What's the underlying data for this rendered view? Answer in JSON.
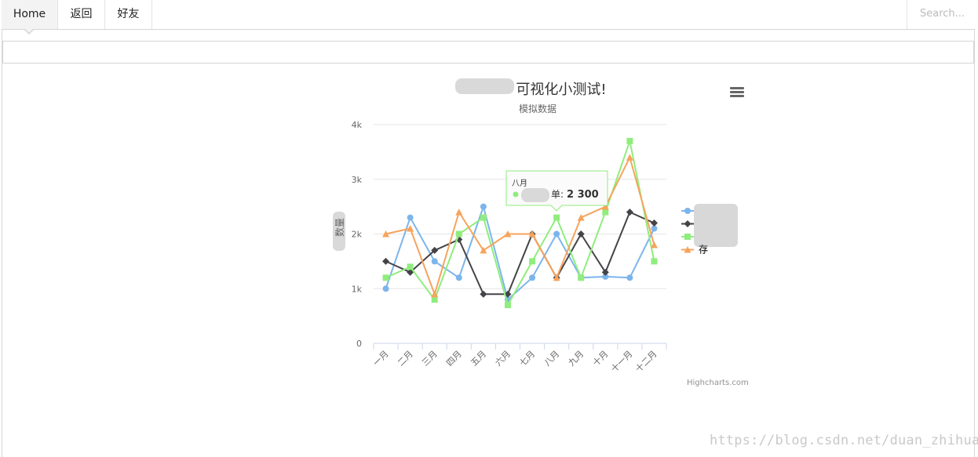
{
  "nav": {
    "items": [
      {
        "label": "Home",
        "active": true
      },
      {
        "label": "返回",
        "active": false
      },
      {
        "label": "好友",
        "active": false
      }
    ],
    "search_placeholder": "Search..."
  },
  "chart_data": {
    "type": "line",
    "title": "可视化小测试!",
    "subtitle": "模拟数据",
    "ylabel": "数量",
    "ylim": [
      0,
      4000
    ],
    "yticks": [
      {
        "value": 0,
        "label": "0"
      },
      {
        "value": 1000,
        "label": "1k"
      },
      {
        "value": 2000,
        "label": "2k"
      },
      {
        "value": 3000,
        "label": "3k"
      },
      {
        "value": 4000,
        "label": "4k"
      }
    ],
    "categories": [
      "一月",
      "二月",
      "三月",
      "四月",
      "五月",
      "六月",
      "七月",
      "八月",
      "九月",
      "十月",
      "十一月",
      "十二月"
    ],
    "series": [
      {
        "name": "",
        "color": "#7cb5ec",
        "marker": "circle",
        "values": [
          1000,
          2300,
          1500,
          1200,
          2500,
          800,
          1200,
          2000,
          1200,
          1220,
          1200,
          2100
        ]
      },
      {
        "name": "",
        "color": "#434348",
        "marker": "diamond",
        "values": [
          1500,
          1300,
          1700,
          1900,
          900,
          900,
          2000,
          1200,
          2000,
          1300,
          2400,
          2200
        ]
      },
      {
        "name": "",
        "color": "#90ed7d",
        "marker": "square",
        "values": [
          1200,
          1400,
          800,
          2000,
          2300,
          700,
          1500,
          2300,
          1200,
          2400,
          3700,
          1500
        ]
      },
      {
        "name": "存",
        "color": "#f7a35c",
        "marker": "triangle",
        "values": [
          2000,
          2100,
          900,
          2400,
          1700,
          2000,
          2000,
          1200,
          2300,
          2500,
          3400,
          1800
        ]
      }
    ],
    "tooltip": {
      "category": "八月",
      "label": "单:",
      "value": "2 300",
      "series_index": 2,
      "category_index": 7
    },
    "legend_position": "right",
    "credits": "Highcharts.com",
    "grid": true
  },
  "watermark": "https://blog.csdn.net/duan_zhihua"
}
